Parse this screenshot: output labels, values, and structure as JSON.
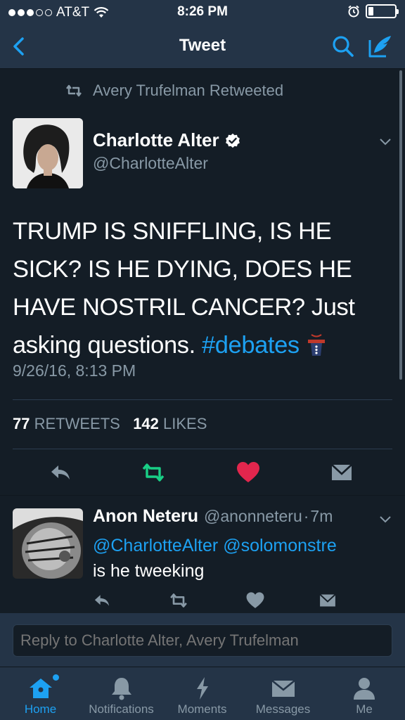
{
  "status_bar": {
    "carrier": "AT&T",
    "time": "8:26 PM"
  },
  "nav": {
    "title": "Tweet",
    "back_icon": "chevron-left-icon",
    "search_icon": "search-icon",
    "compose_icon": "compose-icon"
  },
  "tweet": {
    "retweeted_by": "Avery Trufelman Retweeted",
    "author_name": "Charlotte Alter",
    "author_handle": "@CharlotteAlter",
    "text": "TRUMP IS SNIFFLING, IS HE SICK? IS HE DYING, DOES HE HAVE NOSTRIL CANCER? Just asking questions.",
    "hashtag": "#debates",
    "timestamp": "9/26/16, 8:13 PM",
    "retweets_count": "77",
    "retweets_label": "RETWEETS",
    "likes_count": "142",
    "likes_label": "LIKES"
  },
  "reply": {
    "author_name": "Anon Neteru",
    "author_handle": "@anonneteru",
    "separator": "·",
    "time": "7m",
    "mention1": "@CharlotteAlter",
    "mention2": "@solomonstre",
    "text": "is he tweeking"
  },
  "reply_bar": {
    "placeholder": "Reply to Charlotte Alter, Avery Trufelman"
  },
  "tabs": [
    {
      "label": "Home",
      "icon": "home-icon"
    },
    {
      "label": "Notifications",
      "icon": "bell-icon"
    },
    {
      "label": "Moments",
      "icon": "lightning-icon"
    },
    {
      "label": "Messages",
      "icon": "envelope-icon"
    },
    {
      "label": "Me",
      "icon": "person-icon"
    }
  ],
  "colors": {
    "accent": "#1da1f2",
    "retweet_green": "#19cf86",
    "like_red": "#e2264d",
    "background": "#141d26",
    "bar": "#243447",
    "muted": "#8899a6"
  }
}
